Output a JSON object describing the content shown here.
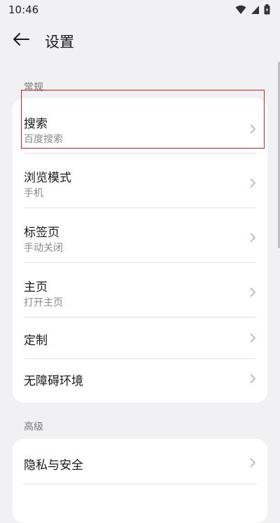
{
  "status": {
    "time": "10:46"
  },
  "header": {
    "title": "设置"
  },
  "sections": [
    {
      "label": "常规",
      "items": [
        {
          "title": "搜索",
          "subtitle": "百度搜索"
        },
        {
          "title": "浏览模式",
          "subtitle": "手机"
        },
        {
          "title": "标签页",
          "subtitle": "手动关闭"
        },
        {
          "title": "主页",
          "subtitle": "打开主页"
        },
        {
          "title": "定制"
        },
        {
          "title": "无障碍环境"
        }
      ]
    },
    {
      "label": "高级",
      "items": [
        {
          "title": "隐私与安全"
        }
      ]
    }
  ],
  "colors": {
    "highlight": "#e02020",
    "background": "#f1f1f4",
    "card": "#ffffff"
  }
}
